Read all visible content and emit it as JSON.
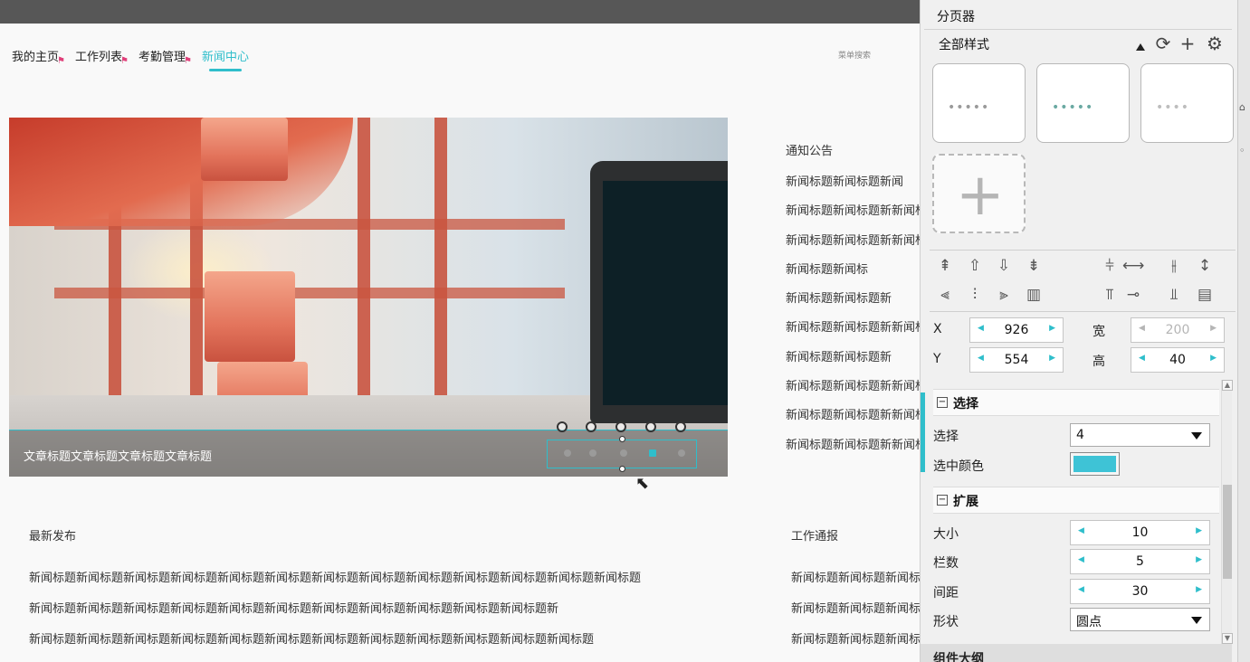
{
  "nav": {
    "items": [
      "我的主页",
      "工作列表",
      "考勤管理",
      "新闻中心"
    ],
    "active_index": 3,
    "search_label": "菜单搜索"
  },
  "carousel": {
    "caption": "文章标题文章标题文章标题文章标题",
    "dot_count": 5,
    "selected_dot": 4
  },
  "notices": {
    "title": "通知公告",
    "items": [
      "新闻标题新闻标题新闻",
      "新闻标题新闻标题新新闻标",
      "新闻标题新闻标题新新闻标",
      "新闻标题新闻标",
      "新闻标题新闻标题新",
      "新闻标题新闻标题新新闻标",
      "新闻标题新闻标题新",
      "新闻标题新闻标题新新闻标",
      "新闻标题新闻标题新新闻标",
      "新闻标题新闻标题新新闻标"
    ]
  },
  "latest": {
    "title": "最新发布",
    "items": [
      "新闻标题新闻标题新闻标题新闻标题新闻标题新闻标题新闻标题新闻标题新闻标题新闻标题新闻标题新闻标题新闻标题",
      "新闻标题新闻标题新闻标题新闻标题新闻标题新闻标题新闻标题新闻标题新闻标题新闻标题新闻标题新",
      "新闻标题新闻标题新闻标题新闻标题新闻标题新闻标题新闻标题新闻标题新闻标题新闻标题新闻标题新闻标题"
    ]
  },
  "work": {
    "title": "工作通报",
    "items": [
      "新闻标题新闻标题新闻标",
      "新闻标题新闻标题新闻标",
      "新闻标题新闻标题新闻标"
    ]
  },
  "panel": {
    "title": "分页器",
    "style_filter": "全部样式",
    "icons": [
      "refresh-icon",
      "plus-icon",
      "gear-icon"
    ],
    "thumb_dots": [
      "•••••",
      "•••••",
      "••••"
    ],
    "geometry_labels": {
      "x": "X",
      "y": "Y",
      "w": "宽",
      "h": "高"
    },
    "geometry_values": {
      "x": "926",
      "y": "554",
      "w": "200",
      "h": "40"
    },
    "sections": {
      "select": {
        "title": "选择",
        "fields": {
          "select_label": "选择",
          "select_value": "4",
          "color_label": "选中颜色",
          "color_value": "#3ec3d6"
        }
      },
      "extend": {
        "title": "扩展",
        "fields": {
          "size_label": "大小",
          "size_value": "10",
          "cols_label": "栏数",
          "cols_value": "5",
          "gap_label": "间距",
          "gap_value": "30",
          "shape_label": "形状",
          "shape_value": "圆点"
        }
      },
      "bottom": {
        "title": "组件大纲"
      }
    }
  },
  "colors": {
    "accent": "#2fbecb"
  }
}
